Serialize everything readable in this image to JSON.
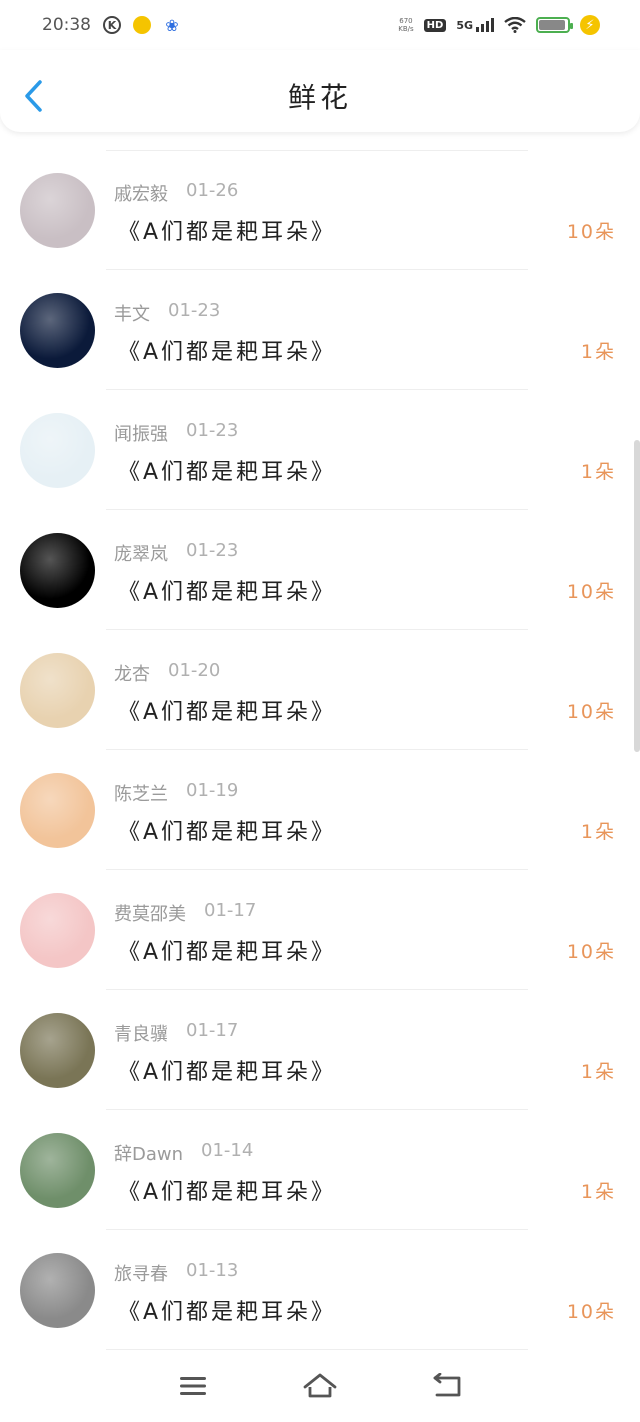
{
  "status_bar": {
    "time": "20:38",
    "net_speed_top": "670",
    "net_speed_bottom": "KB/s",
    "hd": "HD",
    "network": "5G"
  },
  "header": {
    "title": "鲜花"
  },
  "items": [
    {
      "name": "戚宏毅",
      "date": "01-26",
      "message": "《A们都是耙耳朵》",
      "count": "10朵",
      "avatar_color": "#c9bfc4"
    },
    {
      "name": "丰文",
      "date": "01-23",
      "message": "《A们都是耙耳朵》",
      "count": "1朵",
      "avatar_color": "#0b1a3a"
    },
    {
      "name": "闻振强",
      "date": "01-23",
      "message": "《A们都是耙耳朵》",
      "count": "1朵",
      "avatar_color": "#e6f0f5"
    },
    {
      "name": "庞翠岚",
      "date": "01-23",
      "message": "《A们都是耙耳朵》",
      "count": "10朵",
      "avatar_color": "#000000"
    },
    {
      "name": "龙杏",
      "date": "01-20",
      "message": "《A们都是耙耳朵》",
      "count": "10朵",
      "avatar_color": "#e8d2b0"
    },
    {
      "name": "陈芝兰",
      "date": "01-19",
      "message": "《A们都是耙耳朵》",
      "count": "1朵",
      "avatar_color": "#f2c49a"
    },
    {
      "name": "费莫邵美",
      "date": "01-17",
      "message": "《A们都是耙耳朵》",
      "count": "10朵",
      "avatar_color": "#f4c6c6"
    },
    {
      "name": "青良骥",
      "date": "01-17",
      "message": "《A们都是耙耳朵》",
      "count": "1朵",
      "avatar_color": "#7a7556"
    },
    {
      "name": "辞Dawn",
      "date": "01-14",
      "message": "《A们都是耙耳朵》",
      "count": "1朵",
      "avatar_color": "#6f8f6a"
    },
    {
      "name": "旅寻春",
      "date": "01-13",
      "message": "《A们都是耙耳朵》",
      "count": "10朵",
      "avatar_color": "#8a8a8a"
    }
  ],
  "colors": {
    "accent_blue": "#2a9ae8",
    "count_orange": "#e8955a"
  }
}
